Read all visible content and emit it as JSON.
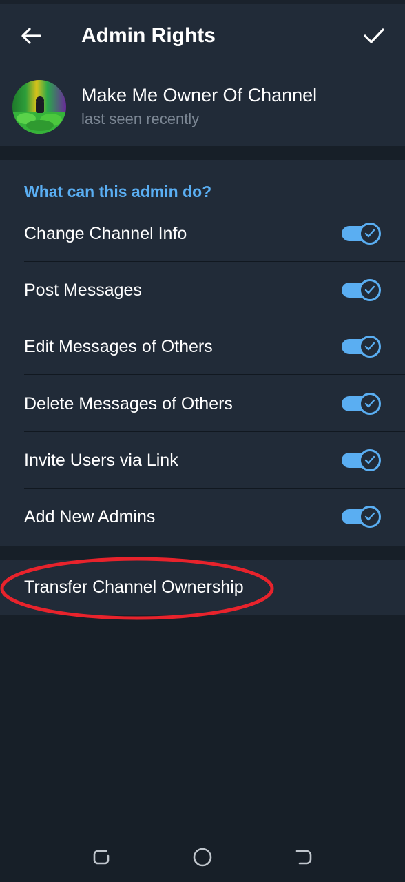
{
  "header": {
    "title": "Admin Rights",
    "back_icon": "arrow-left-icon",
    "done_icon": "checkmark-icon"
  },
  "profile": {
    "name": "Make Me Owner Of Channel",
    "status": "last seen recently"
  },
  "rights": {
    "section_title": "What can this admin do?",
    "items": [
      {
        "label": "Change Channel Info",
        "enabled": true
      },
      {
        "label": "Post Messages",
        "enabled": true
      },
      {
        "label": "Edit Messages of Others",
        "enabled": true
      },
      {
        "label": "Delete Messages of Others",
        "enabled": true
      },
      {
        "label": "Invite Users via Link",
        "enabled": true
      },
      {
        "label": "Add New Admins",
        "enabled": true
      }
    ]
  },
  "transfer": {
    "label": "Transfer Channel Ownership"
  },
  "colors": {
    "accent": "#5aaef2",
    "surface": "#212b38",
    "background": "#171f28",
    "annotation": "#e8232c"
  },
  "nav": {
    "recents_icon": "recents-icon",
    "home_icon": "home-circle-icon",
    "back_icon": "system-back-icon"
  }
}
